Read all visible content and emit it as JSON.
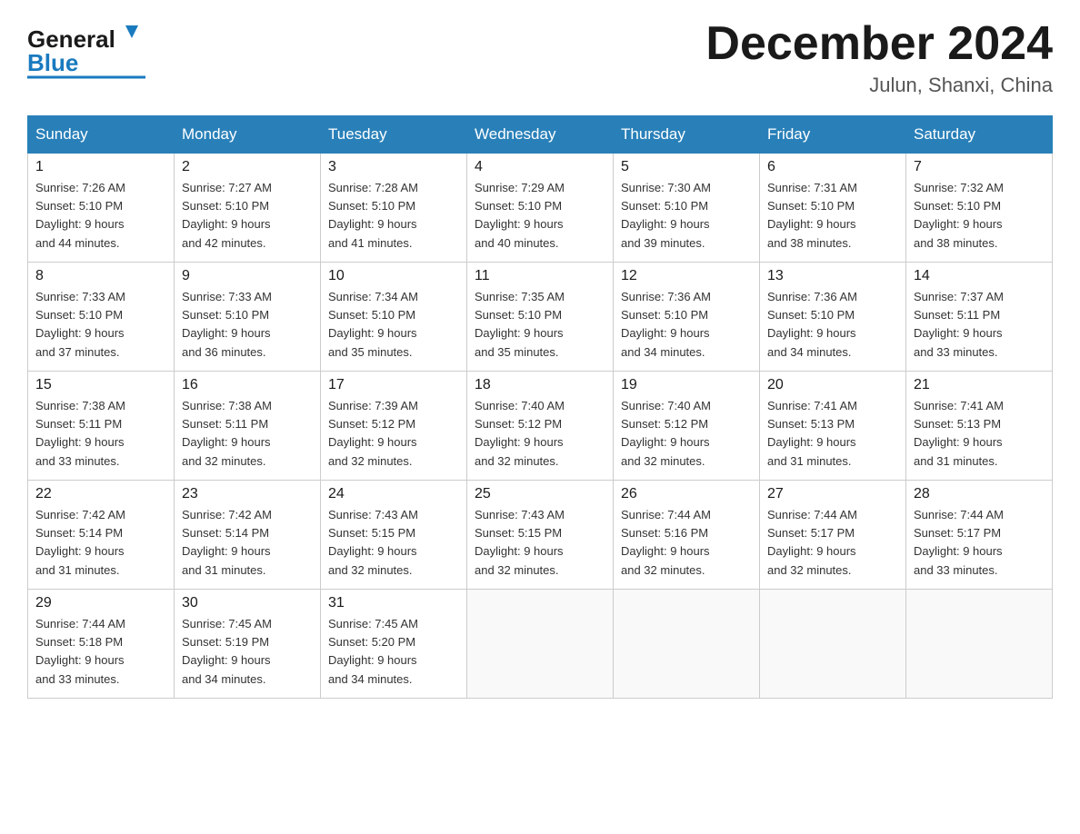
{
  "header": {
    "logo_general": "General",
    "logo_blue": "Blue",
    "month_title": "December 2024",
    "location": "Julun, Shanxi, China"
  },
  "weekdays": [
    "Sunday",
    "Monday",
    "Tuesday",
    "Wednesday",
    "Thursday",
    "Friday",
    "Saturday"
  ],
  "weeks": [
    [
      {
        "day": "1",
        "sunrise": "7:26 AM",
        "sunset": "5:10 PM",
        "daylight": "9 hours and 44 minutes."
      },
      {
        "day": "2",
        "sunrise": "7:27 AM",
        "sunset": "5:10 PM",
        "daylight": "9 hours and 42 minutes."
      },
      {
        "day": "3",
        "sunrise": "7:28 AM",
        "sunset": "5:10 PM",
        "daylight": "9 hours and 41 minutes."
      },
      {
        "day": "4",
        "sunrise": "7:29 AM",
        "sunset": "5:10 PM",
        "daylight": "9 hours and 40 minutes."
      },
      {
        "day": "5",
        "sunrise": "7:30 AM",
        "sunset": "5:10 PM",
        "daylight": "9 hours and 39 minutes."
      },
      {
        "day": "6",
        "sunrise": "7:31 AM",
        "sunset": "5:10 PM",
        "daylight": "9 hours and 38 minutes."
      },
      {
        "day": "7",
        "sunrise": "7:32 AM",
        "sunset": "5:10 PM",
        "daylight": "9 hours and 38 minutes."
      }
    ],
    [
      {
        "day": "8",
        "sunrise": "7:33 AM",
        "sunset": "5:10 PM",
        "daylight": "9 hours and 37 minutes."
      },
      {
        "day": "9",
        "sunrise": "7:33 AM",
        "sunset": "5:10 PM",
        "daylight": "9 hours and 36 minutes."
      },
      {
        "day": "10",
        "sunrise": "7:34 AM",
        "sunset": "5:10 PM",
        "daylight": "9 hours and 35 minutes."
      },
      {
        "day": "11",
        "sunrise": "7:35 AM",
        "sunset": "5:10 PM",
        "daylight": "9 hours and 35 minutes."
      },
      {
        "day": "12",
        "sunrise": "7:36 AM",
        "sunset": "5:10 PM",
        "daylight": "9 hours and 34 minutes."
      },
      {
        "day": "13",
        "sunrise": "7:36 AM",
        "sunset": "5:10 PM",
        "daylight": "9 hours and 34 minutes."
      },
      {
        "day": "14",
        "sunrise": "7:37 AM",
        "sunset": "5:11 PM",
        "daylight": "9 hours and 33 minutes."
      }
    ],
    [
      {
        "day": "15",
        "sunrise": "7:38 AM",
        "sunset": "5:11 PM",
        "daylight": "9 hours and 33 minutes."
      },
      {
        "day": "16",
        "sunrise": "7:38 AM",
        "sunset": "5:11 PM",
        "daylight": "9 hours and 32 minutes."
      },
      {
        "day": "17",
        "sunrise": "7:39 AM",
        "sunset": "5:12 PM",
        "daylight": "9 hours and 32 minutes."
      },
      {
        "day": "18",
        "sunrise": "7:40 AM",
        "sunset": "5:12 PM",
        "daylight": "9 hours and 32 minutes."
      },
      {
        "day": "19",
        "sunrise": "7:40 AM",
        "sunset": "5:12 PM",
        "daylight": "9 hours and 32 minutes."
      },
      {
        "day": "20",
        "sunrise": "7:41 AM",
        "sunset": "5:13 PM",
        "daylight": "9 hours and 31 minutes."
      },
      {
        "day": "21",
        "sunrise": "7:41 AM",
        "sunset": "5:13 PM",
        "daylight": "9 hours and 31 minutes."
      }
    ],
    [
      {
        "day": "22",
        "sunrise": "7:42 AM",
        "sunset": "5:14 PM",
        "daylight": "9 hours and 31 minutes."
      },
      {
        "day": "23",
        "sunrise": "7:42 AM",
        "sunset": "5:14 PM",
        "daylight": "9 hours and 31 minutes."
      },
      {
        "day": "24",
        "sunrise": "7:43 AM",
        "sunset": "5:15 PM",
        "daylight": "9 hours and 32 minutes."
      },
      {
        "day": "25",
        "sunrise": "7:43 AM",
        "sunset": "5:15 PM",
        "daylight": "9 hours and 32 minutes."
      },
      {
        "day": "26",
        "sunrise": "7:44 AM",
        "sunset": "5:16 PM",
        "daylight": "9 hours and 32 minutes."
      },
      {
        "day": "27",
        "sunrise": "7:44 AM",
        "sunset": "5:17 PM",
        "daylight": "9 hours and 32 minutes."
      },
      {
        "day": "28",
        "sunrise": "7:44 AM",
        "sunset": "5:17 PM",
        "daylight": "9 hours and 33 minutes."
      }
    ],
    [
      {
        "day": "29",
        "sunrise": "7:44 AM",
        "sunset": "5:18 PM",
        "daylight": "9 hours and 33 minutes."
      },
      {
        "day": "30",
        "sunrise": "7:45 AM",
        "sunset": "5:19 PM",
        "daylight": "9 hours and 34 minutes."
      },
      {
        "day": "31",
        "sunrise": "7:45 AM",
        "sunset": "5:20 PM",
        "daylight": "9 hours and 34 minutes."
      },
      null,
      null,
      null,
      null
    ]
  ],
  "labels": {
    "sunrise": "Sunrise:",
    "sunset": "Sunset:",
    "daylight": "Daylight:"
  }
}
